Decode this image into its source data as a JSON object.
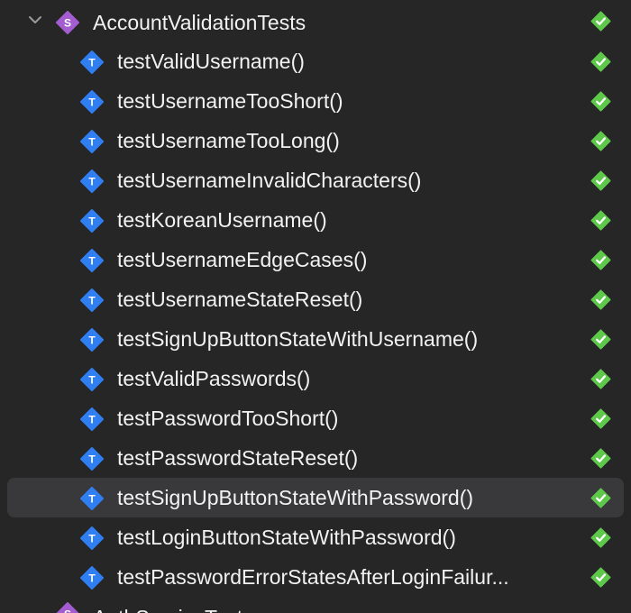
{
  "navigator": {
    "group": {
      "badge": "S",
      "name": "AccountValidationTests",
      "status": "passed"
    },
    "tests": [
      {
        "badge": "T",
        "name": "testValidUsername()",
        "status": "passed"
      },
      {
        "badge": "T",
        "name": "testUsernameTooShort()",
        "status": "passed"
      },
      {
        "badge": "T",
        "name": "testUsernameTooLong()",
        "status": "passed"
      },
      {
        "badge": "T",
        "name": "testUsernameInvalidCharacters()",
        "status": "passed"
      },
      {
        "badge": "T",
        "name": "testKoreanUsername()",
        "status": "passed"
      },
      {
        "badge": "T",
        "name": "testUsernameEdgeCases()",
        "status": "passed"
      },
      {
        "badge": "T",
        "name": "testUsernameStateReset()",
        "status": "passed"
      },
      {
        "badge": "T",
        "name": "testSignUpButtonStateWithUsername()",
        "status": "passed"
      },
      {
        "badge": "T",
        "name": "testValidPasswords()",
        "status": "passed"
      },
      {
        "badge": "T",
        "name": "testPasswordTooShort()",
        "status": "passed"
      },
      {
        "badge": "T",
        "name": "testPasswordStateReset()",
        "status": "passed"
      },
      {
        "badge": "T",
        "name": "testSignUpButtonStateWithPassword()",
        "status": "passed",
        "selected": true
      },
      {
        "badge": "T",
        "name": "testLoginButtonStateWithPassword()",
        "status": "passed"
      },
      {
        "badge": "T",
        "name": "testPasswordErrorStatesAfterLoginFailur...",
        "status": "passed"
      }
    ],
    "next_group": {
      "badge": "S",
      "name": "AuthServiceTests"
    }
  },
  "colors": {
    "background": "#262627",
    "selected_row": "#39393b",
    "text": "#f2f2f2",
    "test_badge": "#2f7ff3",
    "suite_badge": "#a35dd0",
    "pass_check": "#5ec84a",
    "chevron": "#9a9a9a"
  }
}
